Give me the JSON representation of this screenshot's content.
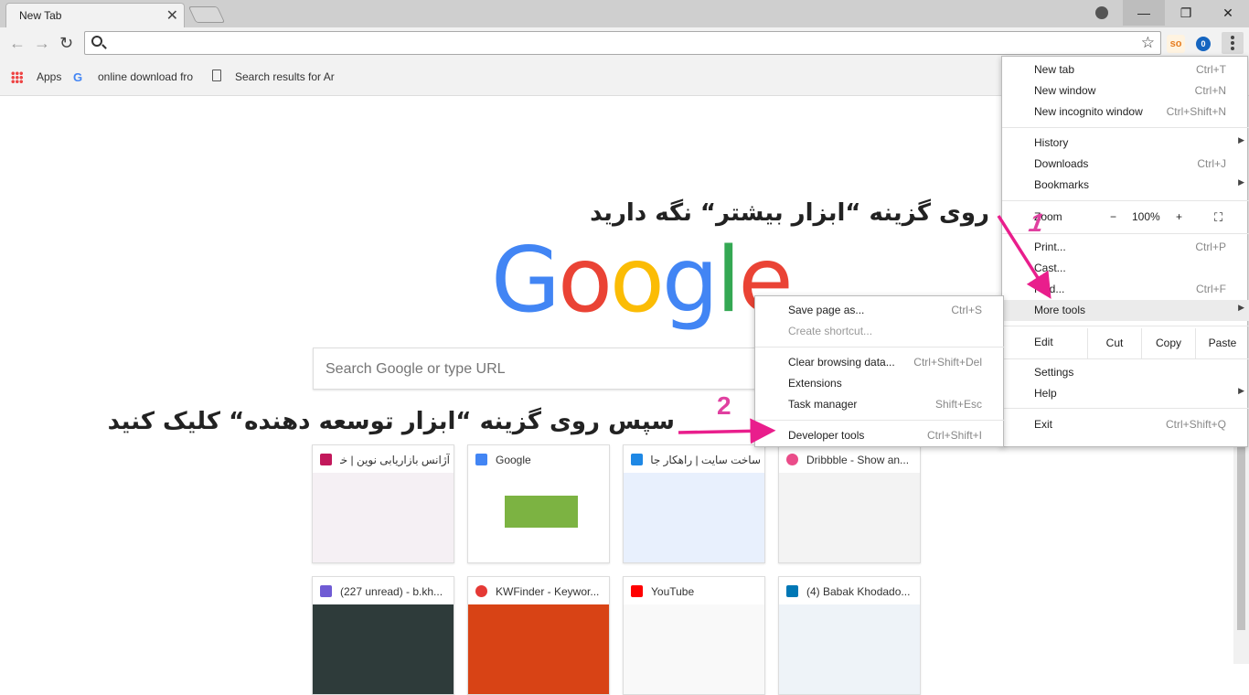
{
  "window": {
    "tab_title": "New Tab",
    "tab_close": "✕",
    "min_glyph": "—",
    "max_glyph": "❐",
    "close_glyph": "✕"
  },
  "toolbar": {
    "back_glyph": "←",
    "forward_glyph": "→",
    "reload_glyph": "↻",
    "star_glyph": "☆",
    "ext1_label": "so",
    "ext2_label": "0"
  },
  "bookmarks": [
    {
      "label": "Apps",
      "icon": "apps-grid-icon"
    },
    {
      "label": "online download fro",
      "icon": "google-g-icon"
    },
    {
      "label": "Search results for Ar",
      "icon": "page-icon"
    }
  ],
  "page": {
    "logo_letters": [
      "G",
      "o",
      "o",
      "g",
      "l",
      "e"
    ],
    "logo_colors": [
      "#4285F4",
      "#EA4335",
      "#FBBC05",
      "#4285F4",
      "#34A853",
      "#EA4335"
    ],
    "search_placeholder": "Search Google or type URL"
  },
  "tiles": [
    {
      "title": "آژانس بازاریابی نوین | خدمـ",
      "icon_color": "#c2185b",
      "thumb_color": "#f5f0f4"
    },
    {
      "title": "Google",
      "icon_color": "#4285F4",
      "thumb_color": "#ffffff"
    },
    {
      "title": "ساخت سایت | راهکار جامع",
      "icon_color": "#1e88e5",
      "thumb_color": "#e8f0fd"
    },
    {
      "title": "Dribbble - Show an...",
      "icon_color": "#ea4c89",
      "thumb_color": "#f3f3f3"
    },
    {
      "title": "(227 unread) - b.kh...",
      "icon_color": "#6f5bd4",
      "thumb_color": "#2e3b3a"
    },
    {
      "title": "KWFinder - Keywor...",
      "icon_color": "#e53935",
      "thumb_color": "#d84315"
    },
    {
      "title": "YouTube",
      "icon_color": "#ff0000",
      "thumb_color": "#f9f9f9"
    },
    {
      "title": "(4) Babak Khodado...",
      "icon_color": "#0077b5",
      "thumb_color": "#eef3f8"
    }
  ],
  "main_menu": {
    "new_tab": {
      "label": "New tab",
      "shortcut": "Ctrl+T"
    },
    "new_window": {
      "label": "New window",
      "shortcut": "Ctrl+N"
    },
    "incognito": {
      "label": "New incognito window",
      "shortcut": "Ctrl+Shift+N"
    },
    "history": {
      "label": "History"
    },
    "downloads": {
      "label": "Downloads",
      "shortcut": "Ctrl+J"
    },
    "bookmarks": {
      "label": "Bookmarks"
    },
    "zoom": {
      "label": "Zoom",
      "minus": "−",
      "value": "100%",
      "plus": "+"
    },
    "print": {
      "label": "Print...",
      "shortcut": "Ctrl+P"
    },
    "cast": {
      "label": "Cast..."
    },
    "find": {
      "label": "Find...",
      "shortcut": "Ctrl+F"
    },
    "more_tools": {
      "label": "More tools"
    },
    "edit": {
      "label": "Edit",
      "cut": "Cut",
      "copy": "Copy",
      "paste": "Paste"
    },
    "settings": {
      "label": "Settings"
    },
    "help": {
      "label": "Help"
    },
    "exit": {
      "label": "Exit",
      "shortcut": "Ctrl+Shift+Q"
    }
  },
  "submenu": {
    "save_page": {
      "label": "Save page as...",
      "shortcut": "Ctrl+S"
    },
    "create_shortcut": {
      "label": "Create shortcut..."
    },
    "clear_data": {
      "label": "Clear browsing data...",
      "shortcut": "Ctrl+Shift+Del"
    },
    "extensions": {
      "label": "Extensions"
    },
    "task_manager": {
      "label": "Task manager",
      "shortcut": "Shift+Esc"
    },
    "dev_tools": {
      "label": "Developer tools",
      "shortcut": "Ctrl+Shift+I"
    }
  },
  "annotations": {
    "step1_text": "روی گزینه “ابزار بیشتر“ نگه دارید",
    "step1_number": "1",
    "step2_text": "سپس روی گزینه “ابزار توسعه دهنده“ کلیک کنید",
    "step2_number": "2",
    "number_color": "#e040a0",
    "arrow_color": "#e91e8c"
  }
}
